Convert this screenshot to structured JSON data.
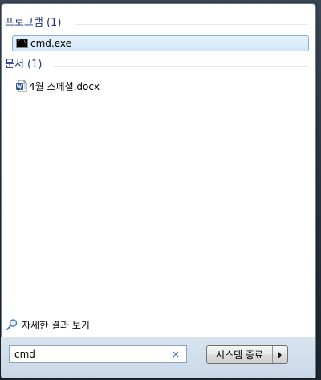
{
  "results": {
    "programs": {
      "header": "프로그램 (1)",
      "items": [
        {
          "label": "cmd.exe",
          "icon": "cmd-icon",
          "selected": true
        }
      ]
    },
    "documents": {
      "header": "문서 (1)",
      "items": [
        {
          "label": "4월 스페셜.docx",
          "icon": "word-document-icon",
          "selected": false
        }
      ]
    }
  },
  "see_more": {
    "label": "자세한 결과 보기",
    "icon": "magnifier-icon"
  },
  "search": {
    "value": "cmd",
    "clear_icon": "clear-x-icon",
    "clear_glyph": "×"
  },
  "shutdown": {
    "label": "시스템 종료",
    "arrow_icon": "right-arrow-icon"
  },
  "cmd_icon_glyph": "C:\\",
  "colors": {
    "group_header": "#1e3287",
    "selection_border": "#84acdd",
    "bottom_bar": "#d0dded"
  }
}
